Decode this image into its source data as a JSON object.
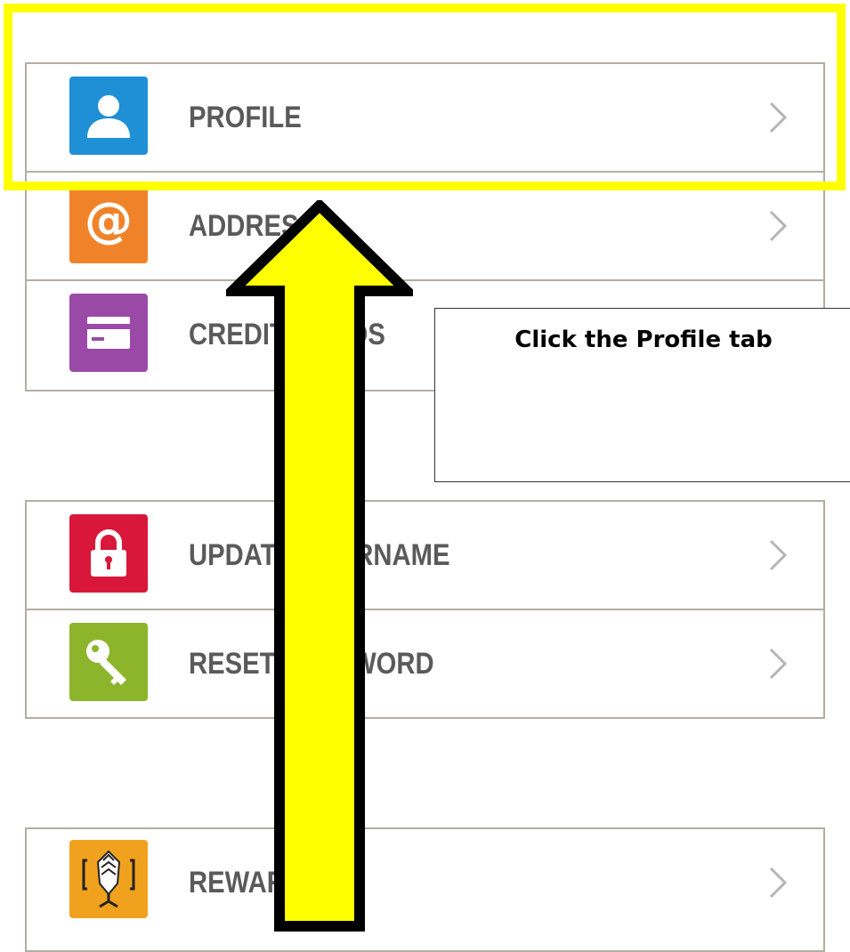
{
  "menu": {
    "group1": [
      {
        "label": "PROFILE",
        "icon": "person-icon",
        "color": "#1f8fd6"
      },
      {
        "label": "ADDRESS",
        "icon": "at-sign-icon",
        "color": "#f0832a"
      },
      {
        "label": "CREDIT CARDS",
        "icon": "credit-card-icon",
        "color": "#9a4aa6"
      }
    ],
    "group2": [
      {
        "label": "UPDATE USERNAME",
        "icon": "lock-icon",
        "color": "#d9173a"
      },
      {
        "label": "RESET PASSWORD",
        "icon": "key-icon",
        "color": "#8db52b"
      }
    ],
    "group3": [
      {
        "label": "REWARDS",
        "icon": "rewards-icon",
        "color": "#f0a21f"
      }
    ]
  },
  "annotation": {
    "callout_text": "Click the Profile tab",
    "highlight_color": "#ffff00",
    "arrow_color": "#ffff00"
  }
}
